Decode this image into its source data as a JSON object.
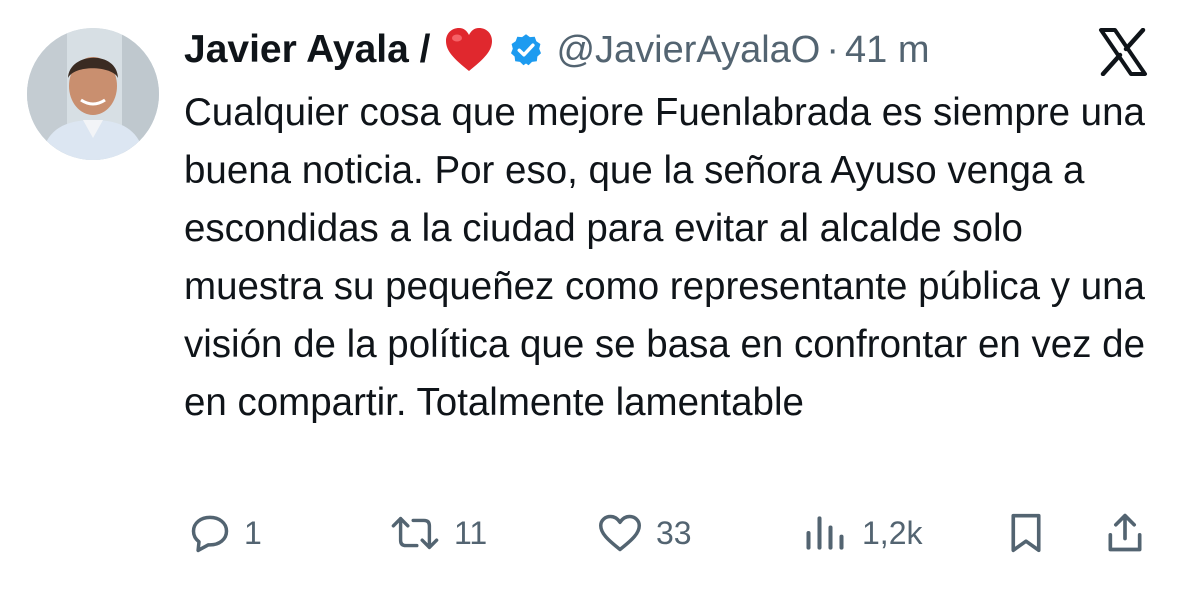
{
  "author": {
    "name": "Javier Ayala /",
    "handle": "@JavierAyalaO",
    "separator": "·",
    "time": "41 m"
  },
  "icons": {
    "heart": "red-heart-emoji",
    "verified": "verified-badge-icon",
    "platform": "x-logo-icon"
  },
  "colors": {
    "text": "#0f1419",
    "secondary": "#536471",
    "verified": "#1d9bf0",
    "heart": "#e0282e"
  },
  "tweet": {
    "text": "Cualquier cosa que mejore Fuenlabrada es siempre una buena noticia. Por eso, que la señora Ayuso venga a escondidas a la ciudad para evitar al alcalde solo muestra su pequeñez como representante pública y una visión de la política que se basa en confrontar en vez de en compartir. Totalmente lamentable"
  },
  "actions": {
    "replies": "1",
    "reposts": "11",
    "likes": "33",
    "views": "1,2k"
  }
}
